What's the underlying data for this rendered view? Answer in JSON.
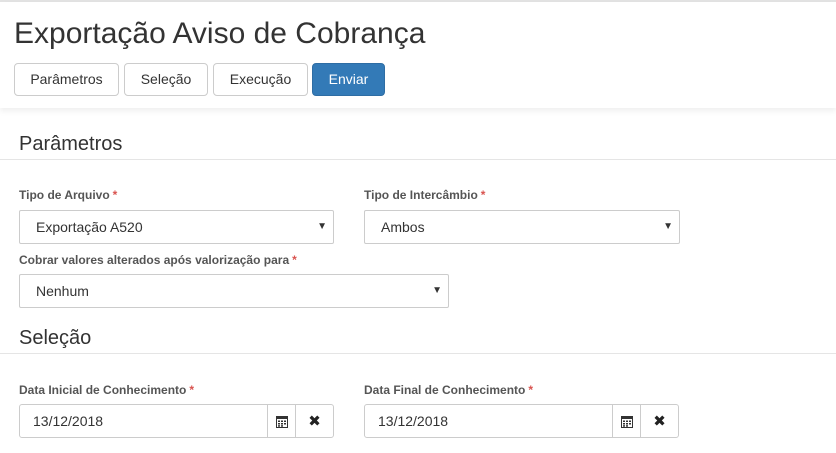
{
  "page": {
    "title": "Exportação Aviso de Cobrança"
  },
  "tabs": {
    "parametros": "Parâmetros",
    "selecao": "Seleção",
    "execucao": "Execução",
    "enviar": "Enviar"
  },
  "colors": {
    "primary": "#337ab7",
    "required": "#d9534f"
  },
  "sections": {
    "parametros": {
      "title": "Parâmetros",
      "tipo_arquivo": {
        "label": "Tipo de Arquivo",
        "required": "*",
        "value": "Exportação A520"
      },
      "tipo_intercambio": {
        "label": "Tipo de Intercâmbio",
        "required": "*",
        "value": "Ambos"
      },
      "cobrar_valores": {
        "label": "Cobrar valores alterados após valorização para",
        "required": "*",
        "value": "Nenhum"
      }
    },
    "selecao": {
      "title": "Seleção",
      "data_inicial": {
        "label": "Data Inicial de Conhecimento",
        "required": "*",
        "value": "13/12/2018"
      },
      "data_final": {
        "label": "Data Final de Conhecimento",
        "required": "*",
        "value": "13/12/2018"
      }
    }
  },
  "icons": {
    "dropdown": "caret-down-icon",
    "calendar": "calendar-icon",
    "clear": "clear-x-icon"
  }
}
